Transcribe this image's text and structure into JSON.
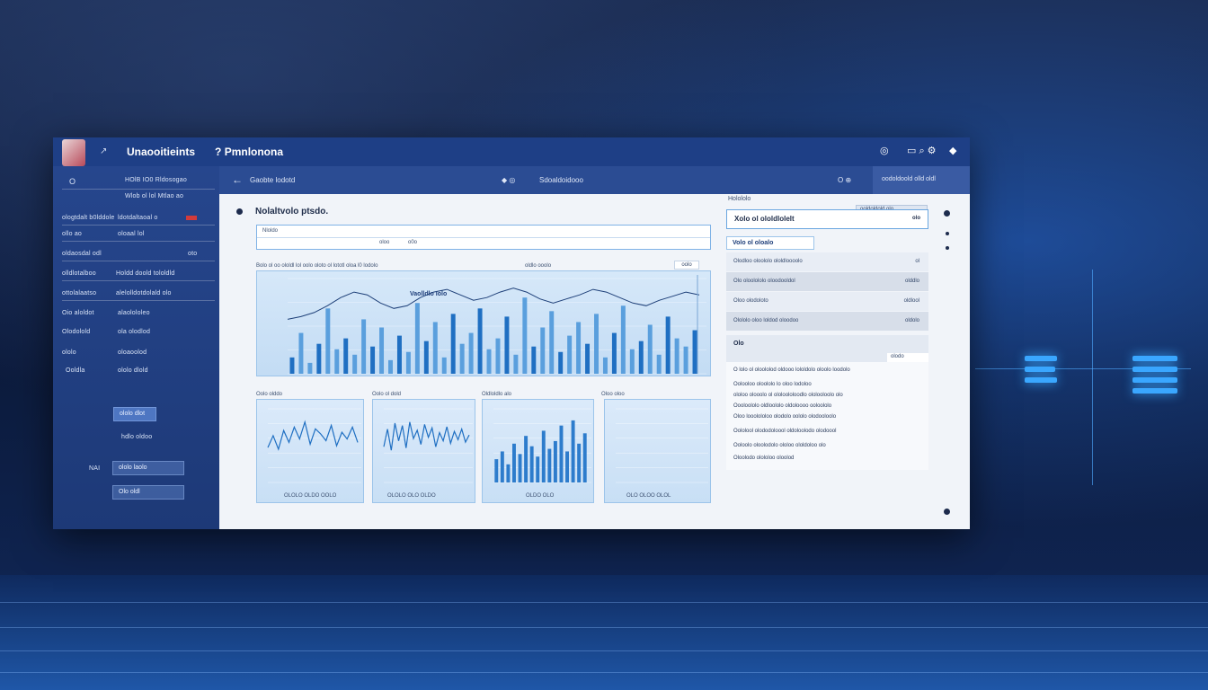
{
  "window": {
    "title_primary": "Unaooitieints",
    "title_secondary": "Pmnlonona",
    "title_icon_glyph": "?",
    "title_caret": "↗",
    "right_icons": [
      "◎",
      "▭ ⌕ ⚙",
      "◆"
    ]
  },
  "sidebar": {
    "header_label": "O",
    "header_right": "HOlB IO0 Rldosogao",
    "rows": [
      {
        "left": "",
        "right": "Wlob ol lol Mtlao ao"
      },
      {
        "left": "ologtdalt b0lddole",
        "right": "ldotdaltaoal o"
      },
      {
        "left": "ollo ao",
        "right": "oloaal lol"
      },
      {
        "left": "oldaosdal odl",
        "right": "oto"
      },
      {
        "left": "olldlotalboo",
        "right": "Holdd doold tololdld"
      },
      {
        "left": "ottolalaatso",
        "right": "alelolldotdolald olo"
      },
      {
        "left": "Oio aloldot",
        "right": "alaolololeo"
      },
      {
        "left": "Olodolold",
        "right": "ola olodlod"
      },
      {
        "left": "ololo",
        "right": "oloaoolod"
      },
      {
        "left": "Ooldla",
        "right": "ololo dlold"
      }
    ],
    "btn_primary": "ololo dlot",
    "small_row": "hdlo oldoo",
    "btn_secondary": "ololo laolo",
    "side_label": "NAI",
    "btn_tertiary": "Olo oldl"
  },
  "toolbar": {
    "back_glyph": "←",
    "breadcrumb": "Gaobte lodotd",
    "center_label": "Sdoaldoidooo",
    "right_icons": "O  ⊕",
    "panel_label": "oodoldoold olld oldl"
  },
  "content": {
    "heading": "Nolaltvolo ptsdo.",
    "filter_field_1": "Nloldo",
    "filter_field_2": "oloo",
    "filter_field_3": "o0o",
    "chart_section_label": "Bolo ol oo ololdl lol oolo oloto ol lototl oloa l0 lodolo",
    "chart_section_right": "oldlo ooolo",
    "chart_badge": "oolo",
    "chart_overlay": "Vaolldlo Iolo",
    "mini_labels": [
      "Oolo olddo",
      "Oolo ol dold",
      "Oldloldlo alo",
      "Oloo oloo"
    ],
    "mini_captions": [
      "OLOLO OLDO OOLO",
      "OLOLO OLO OLDO",
      "OLDO OLO",
      "OLO OLOO OLOL"
    ],
    "right_badge": "ooldoldold olo"
  },
  "right_panel": {
    "top_label": "Holololo",
    "title": "Xolo ol ololdlolelt",
    "title_badge": "olo",
    "subtitle": "Volo ol oloalo",
    "rows": [
      {
        "label": "Olodloo oloololo ololdloooolo",
        "value": "ol"
      },
      {
        "label": "Olo oloolololo oloodooldol",
        "value": "olddlo"
      },
      {
        "label": "Oloo olodoloto",
        "value": "oldlool"
      },
      {
        "label": "Olololo oloo loldod oloodoo",
        "value": "oldolo"
      }
    ],
    "section": "Olo",
    "section_right": "olodo",
    "paragraph": [
      "O lolo ol oloololod oldooo lololdolo oloolo loodolo",
      "Oolooloo oloololo lo oloo lodoloo",
      "ololoo olooolo ol ololoololoodlo ololooloolo olo",
      "Oooloololo oldloololo oldoloooo ooloololo",
      "Oloo looolololoo olodolo oololo olodooloolo",
      "Oololool olododoloool oldoloolodo olodoool",
      "Ooloolo oloolodolo ololoo ololdoloo olo",
      "Oloolodo olololoo oloolod"
    ]
  },
  "chart_data": [
    {
      "type": "bar",
      "title": "",
      "values": [
        12,
        30,
        8,
        22,
        48,
        18,
        26,
        14,
        40,
        20,
        34,
        10,
        28,
        16,
        52,
        24,
        38,
        12,
        44,
        22,
        30,
        48,
        18,
        26,
        42,
        14,
        56,
        20,
        34,
        46,
        16,
        28,
        38,
        22,
        44,
        12,
        30,
        50,
        18,
        24,
        36,
        14,
        42,
        26,
        20,
        32
      ],
      "line": [
        40,
        42,
        45,
        50,
        56,
        60,
        58,
        52,
        48,
        50,
        56,
        60,
        62,
        58,
        54,
        56,
        60,
        63,
        60,
        55,
        52,
        55,
        58,
        62,
        60,
        56,
        52,
        50,
        54,
        57,
        60,
        58
      ],
      "ylim": [
        0,
        70
      ]
    },
    {
      "type": "line",
      "values": [
        20,
        34,
        18,
        40,
        26,
        44,
        30,
        50,
        24,
        42,
        36,
        28,
        46,
        22,
        38,
        30,
        44,
        26
      ]
    },
    {
      "type": "line",
      "values": [
        30,
        60,
        24,
        70,
        40,
        66,
        28,
        72,
        44,
        58,
        34,
        68,
        46,
        62,
        30,
        54,
        40,
        64,
        36,
        56,
        42,
        60,
        38,
        50
      ]
    },
    {
      "type": "bar",
      "values": [
        18,
        24,
        14,
        30,
        22,
        36,
        28,
        20,
        40,
        26,
        32,
        44,
        24,
        48,
        30,
        38
      ]
    },
    {
      "type": "bar",
      "values": []
    }
  ]
}
